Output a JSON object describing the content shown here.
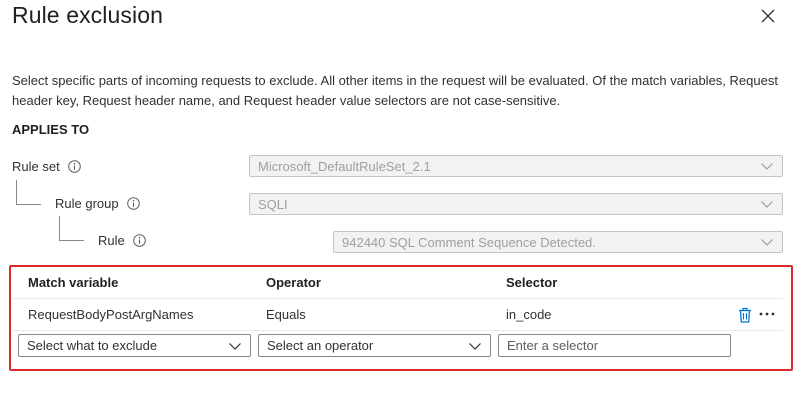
{
  "dialog": {
    "title": "Rule exclusion",
    "close_icon": "close-icon",
    "description": "Select specific parts of incoming requests to exclude. All other items in the request will be evaluated. Of the match variables, Request header key, Request header name, and Request header value selectors are not case-sensitive."
  },
  "applies_to": {
    "heading": "APPLIES TO",
    "rule_set": {
      "label": "Rule set",
      "value": "Microsoft_DefaultRuleSet_2.1"
    },
    "rule_group": {
      "label": "Rule group",
      "value": "SQLI"
    },
    "rule": {
      "label": "Rule",
      "value": "942440 SQL Comment Sequence Detected."
    }
  },
  "exclusions": {
    "columns": [
      "Match variable",
      "Operator",
      "Selector"
    ],
    "rows": [
      {
        "match_variable": "RequestBodyPostArgNames",
        "operator": "Equals",
        "selector": "in_code"
      }
    ],
    "new_row": {
      "match_variable_placeholder": "Select what to exclude",
      "operator_placeholder": "Select an operator",
      "selector_placeholder": "Enter a selector"
    },
    "accent_color": "#d92b2b",
    "delete_icon_color": "#0078d4"
  }
}
